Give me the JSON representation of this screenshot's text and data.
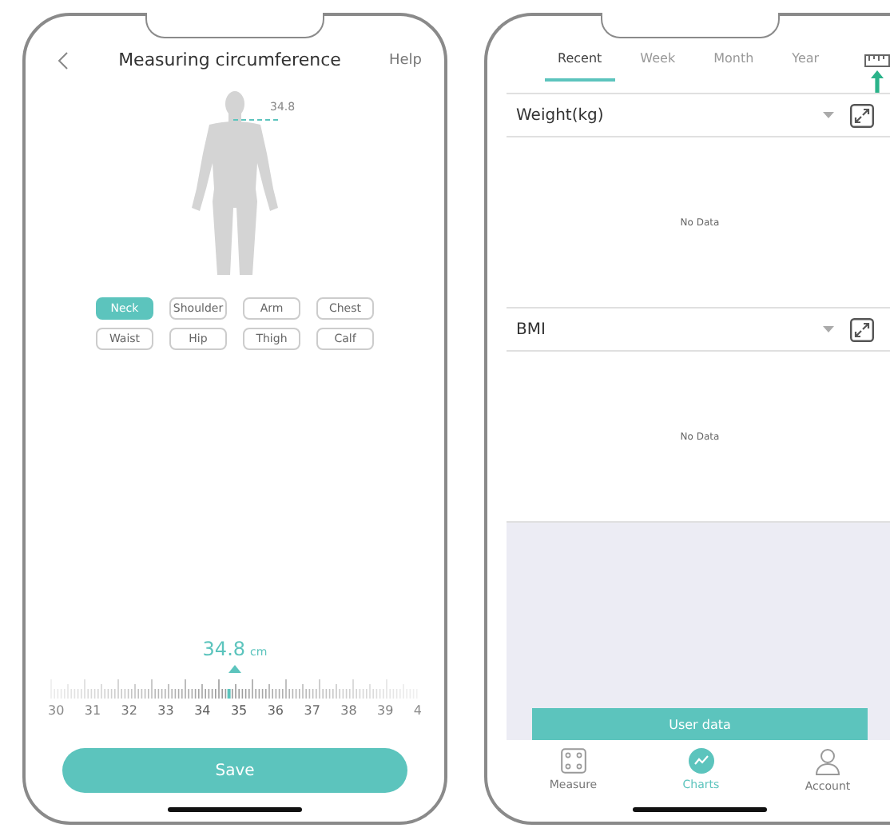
{
  "measure_screen": {
    "title": "Measuring circumference",
    "help": "Help",
    "figure_label": "34.8",
    "body_parts": [
      {
        "label": "Neck",
        "selected": true
      },
      {
        "label": "Shoulder",
        "selected": false
      },
      {
        "label": "Arm",
        "selected": false
      },
      {
        "label": "Chest",
        "selected": false
      },
      {
        "label": "Waist",
        "selected": false
      },
      {
        "label": "Hip",
        "selected": false
      },
      {
        "label": "Thigh",
        "selected": false
      },
      {
        "label": "Calf",
        "selected": false
      }
    ],
    "reading": {
      "value": "34.8",
      "unit": "cm"
    },
    "ruler_labels": [
      "30",
      "31",
      "32",
      "33",
      "34",
      "35",
      "36",
      "37",
      "38",
      "39",
      "4"
    ],
    "save_button": "Save"
  },
  "charts_screen": {
    "tabs": [
      {
        "label": "Recent",
        "selected": true
      },
      {
        "label": "Week",
        "selected": false
      },
      {
        "label": "Month",
        "selected": false
      },
      {
        "label": "Year",
        "selected": false
      }
    ],
    "sections": [
      {
        "title": "Weight(kg)",
        "empty_text": "No Data"
      },
      {
        "title": "BMI",
        "empty_text": "No Data"
      }
    ],
    "user_data_button": "User data",
    "nav": [
      {
        "label": "Measure",
        "selected": false
      },
      {
        "label": "Charts",
        "selected": true
      },
      {
        "label": "Account",
        "selected": false
      }
    ]
  }
}
